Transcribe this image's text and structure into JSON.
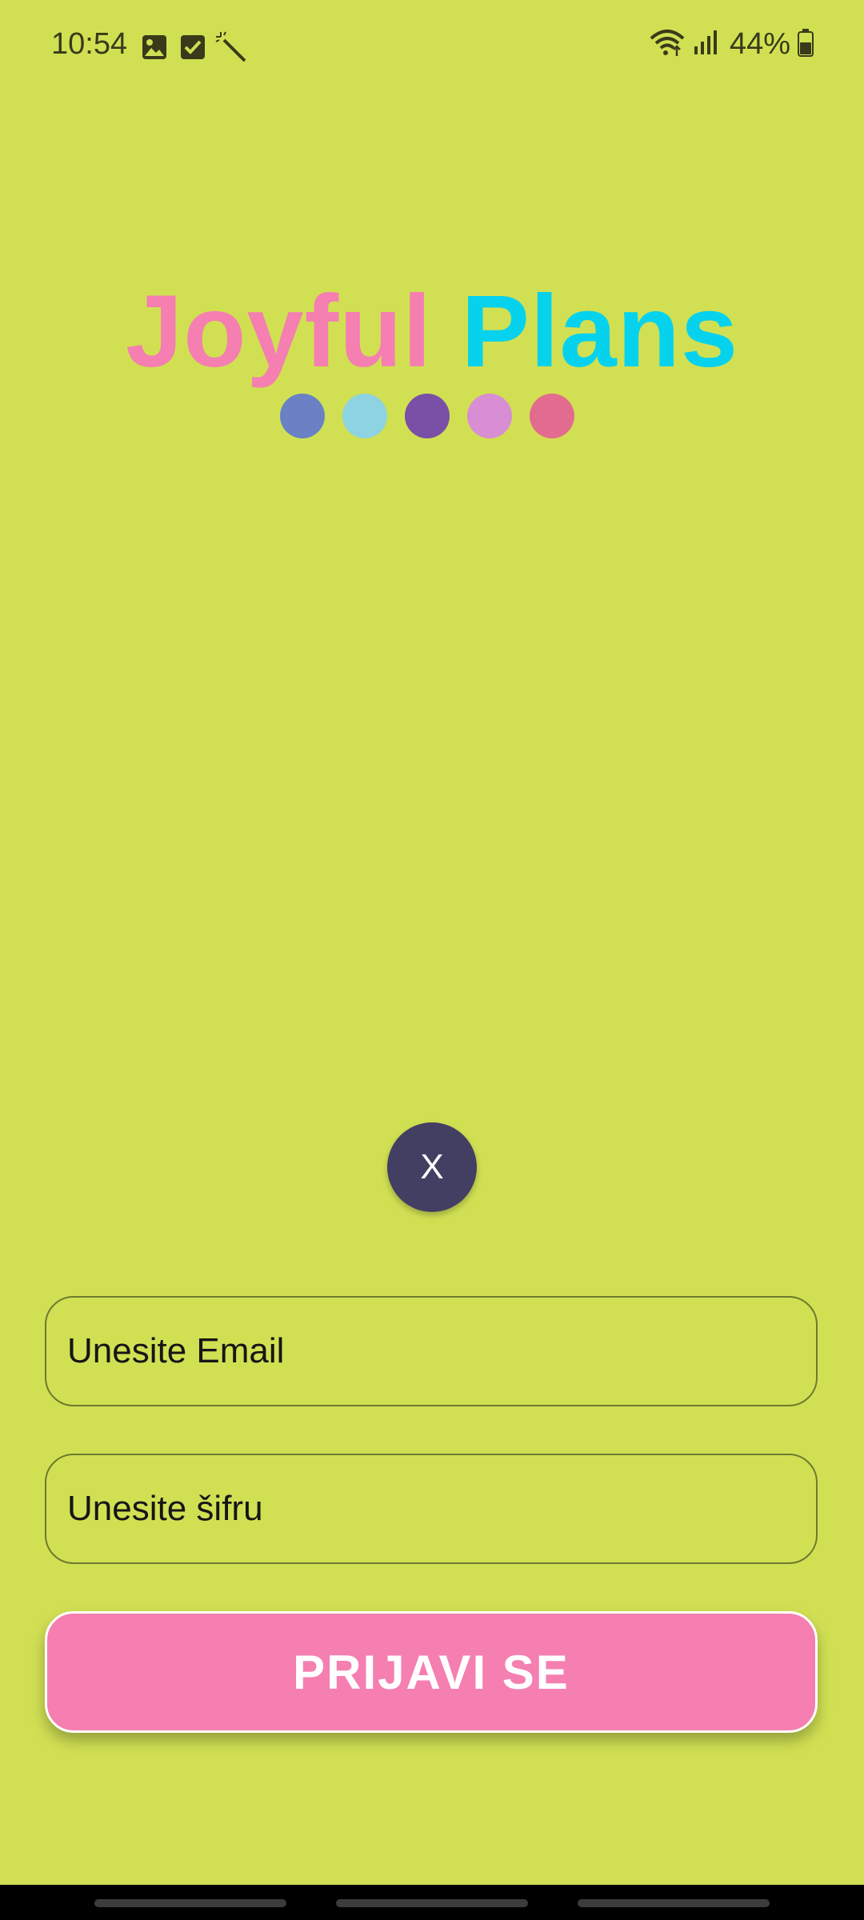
{
  "status_bar": {
    "time": "10:54",
    "left_icons": [
      "image-icon",
      "checkbox-icon",
      "magic-wand-icon"
    ],
    "right_icons": [
      "wifi-icon",
      "signal-icon",
      "battery-icon"
    ],
    "battery": "44%"
  },
  "logo": {
    "word1": "Joyful",
    "word2": "Plans",
    "word1_color": "#f47fb0",
    "word2_color": "#06d2ee",
    "dots": [
      "#6a82c4",
      "#8dd3e2",
      "#7a4fa6",
      "#d88ed2",
      "#e26b8f"
    ]
  },
  "close_button": {
    "label": "X"
  },
  "form": {
    "email_placeholder": "Unesite Email",
    "password_placeholder": "Unesite šifru",
    "submit_label": "PRIJAVI SE"
  },
  "colors": {
    "background": "#d1e053",
    "accent_pink": "#f47fb0",
    "close_button_bg": "#433f63"
  }
}
